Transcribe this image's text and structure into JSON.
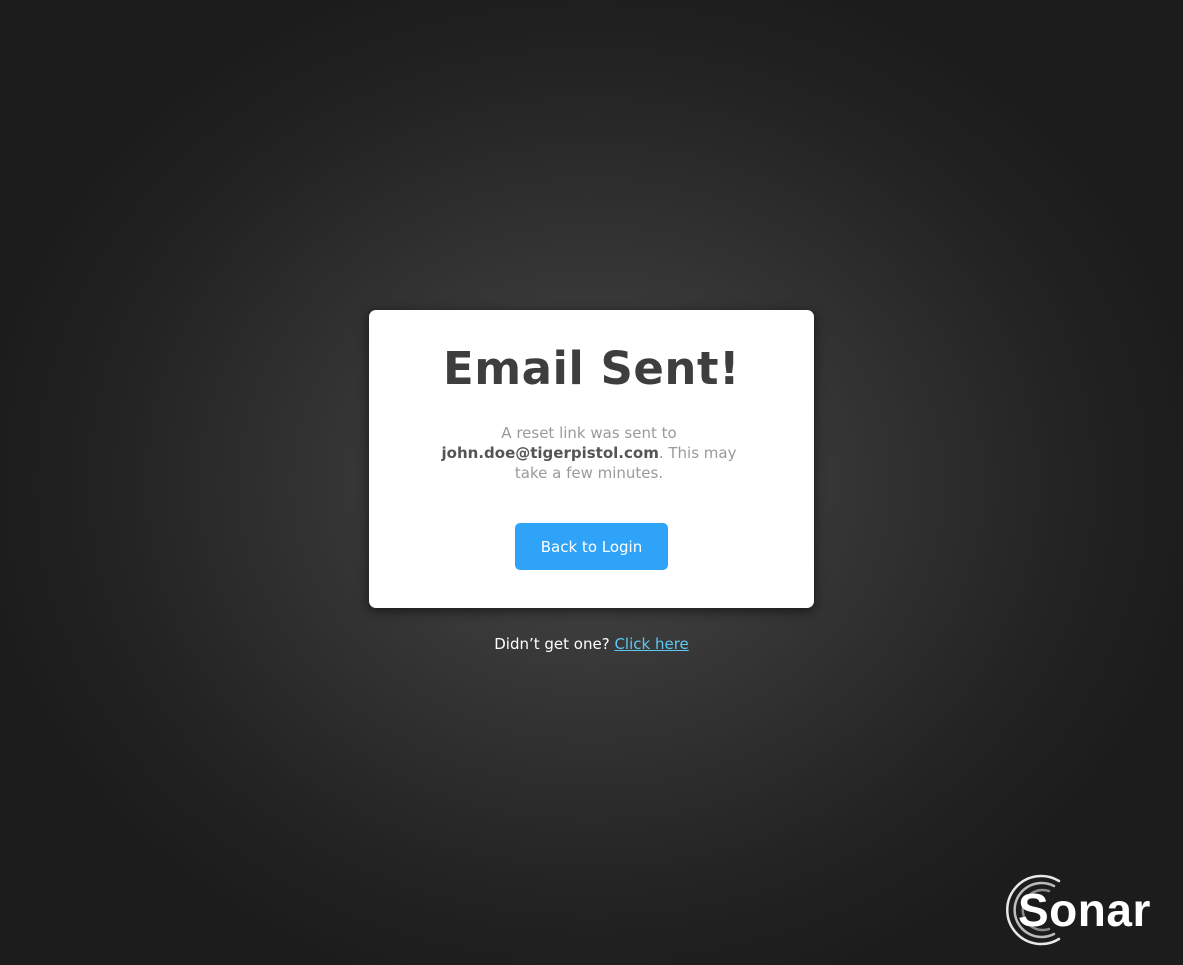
{
  "card": {
    "title": "Email Sent!",
    "message_prefix": "A reset link was sent to",
    "email": "john.doe@tigerpistol.com",
    "message_suffix": ". This may take a few minutes.",
    "back_button_label": "Back to Login"
  },
  "resend": {
    "prompt": "Didn’t get one?",
    "link_label": "Click here"
  },
  "logo": {
    "text": "Sonar",
    "icon": "sonar-rings-icon"
  },
  "colors": {
    "button": "#2ea3f8",
    "link": "#5ec8f3",
    "title": "#3e3e3e",
    "background_center": "#4a4a4a",
    "background_edge": "#1c1c1c"
  }
}
